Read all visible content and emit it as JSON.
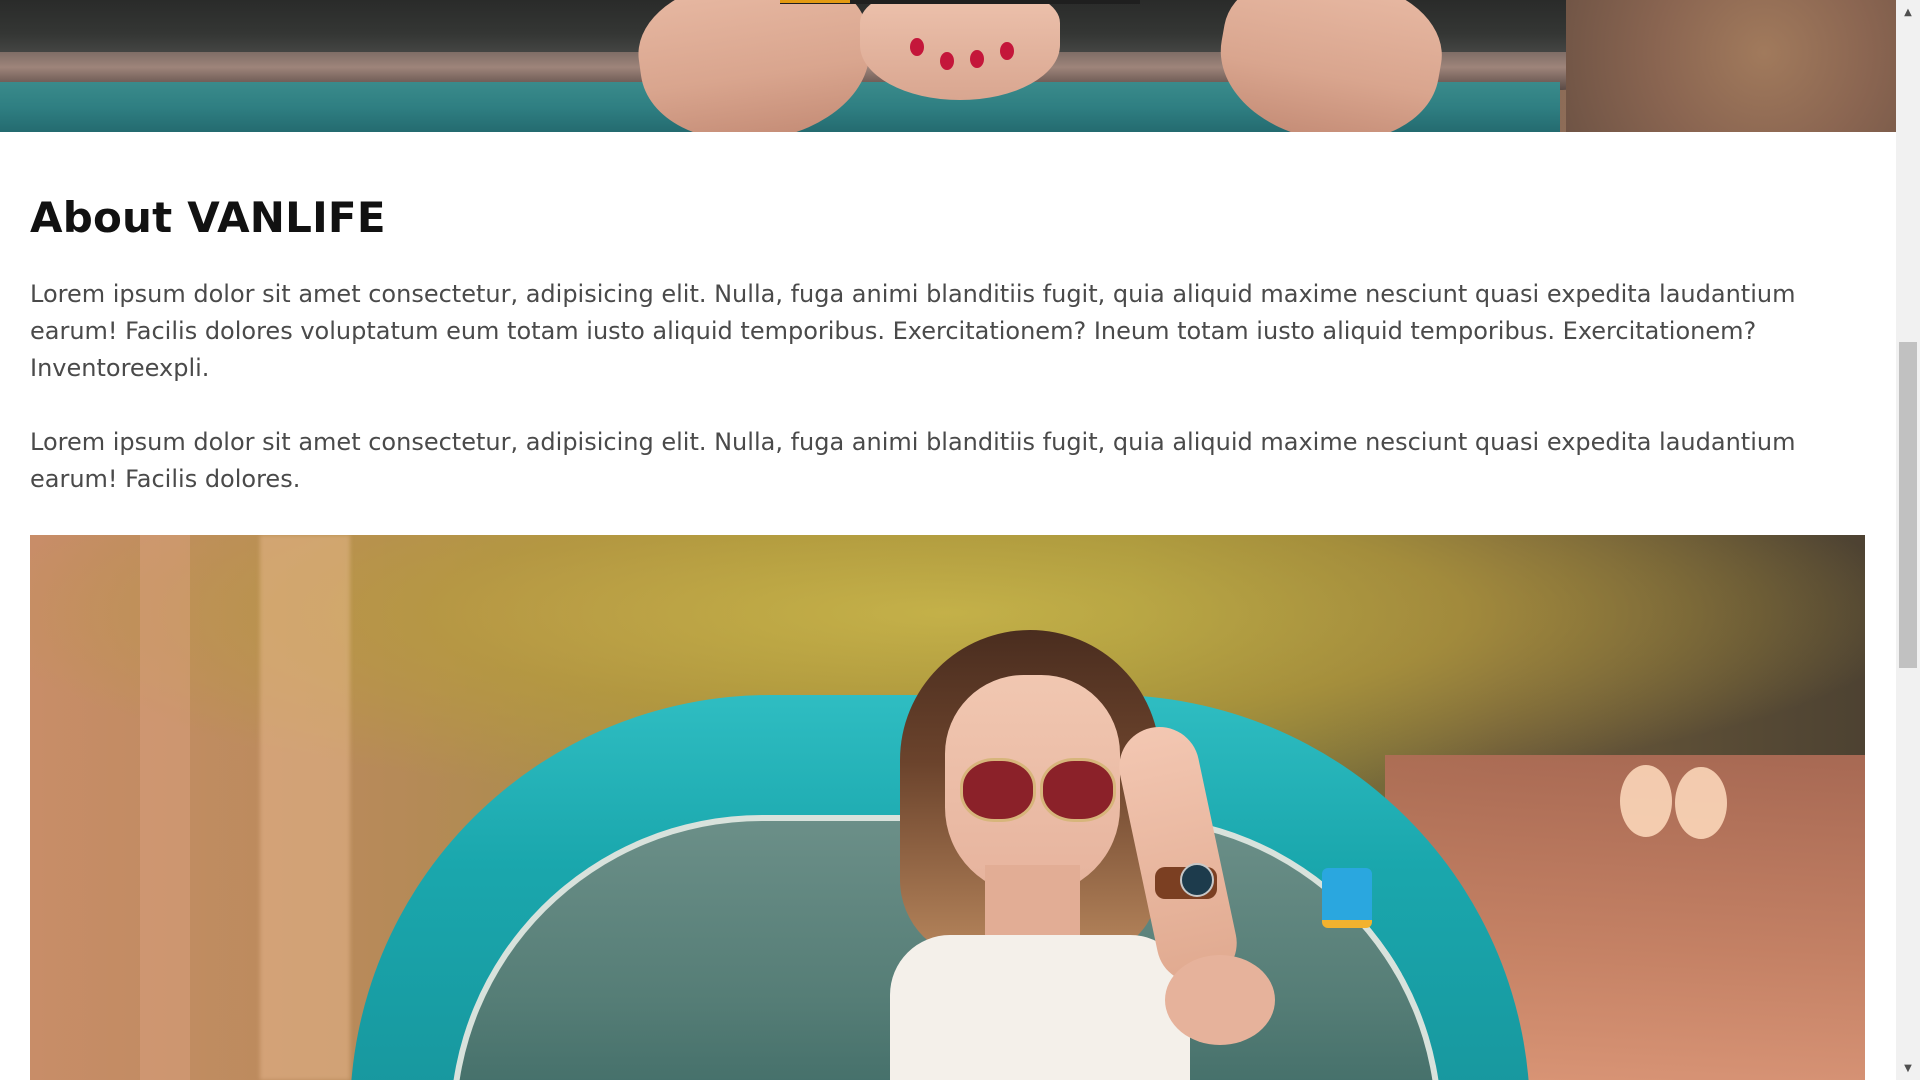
{
  "about": {
    "heading": "About VANLIFE",
    "paragraphs": [
      "Lorem ipsum dolor sit amet consectetur, adipisicing elit. Nulla, fuga animi blanditiis fugit, quia aliquid maxime nesciunt quasi expedita laudantium earum! Facilis dolores voluptatum eum totam iusto aliquid temporibus. Exercitationem? Ineum totam iusto aliquid temporibus. Exercitationem? Inventoreexpli.",
      "Lorem ipsum dolor sit amet consectetur, adipisicing elit. Nulla, fuga animi blanditiis fugit, quia aliquid maxime nesciunt quasi expedita laudantium earum! Facilis dolores."
    ]
  },
  "scrollbar": {
    "up_arrow": "▲",
    "down_arrow": "▼"
  },
  "colors": {
    "heading": "#111111",
    "body_text": "#4a4a4a",
    "accent": "#e39a12",
    "car_teal": "#1aa7ad"
  }
}
